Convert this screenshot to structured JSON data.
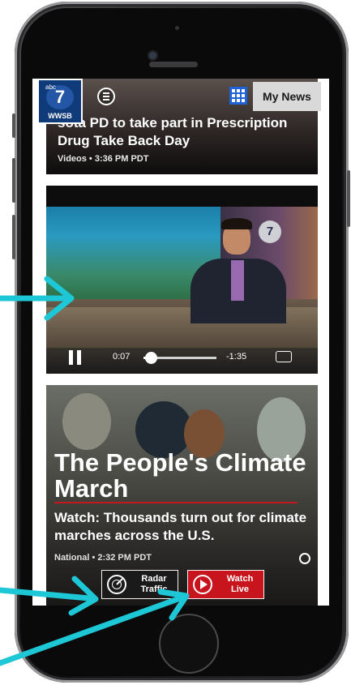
{
  "colors": {
    "annotation_arrow": "#1ec7d6",
    "accent_red": "#c8151d",
    "grid_button_blue": "#1e63d6"
  },
  "app_header": {
    "logo_network": "abc",
    "logo_number": "7",
    "logo_callsign": "WWSB",
    "menu_icon": "hamburger-circle-icon",
    "grid_icon": "grid-icon",
    "my_news_label": "My News"
  },
  "stories": [
    {
      "headline": "sota PD to take part in Prescription Drug Take Back Day",
      "meta": "Videos • 3:36 PM PDT"
    },
    {
      "type": "video",
      "elapsed": "0:07",
      "remaining": "-1:35",
      "progress_fraction": 0.1,
      "badge": "7"
    },
    {
      "overlay_title": "The People's Climate March",
      "headline": "Watch: Thousands turn out for climate marches across the U.S.",
      "meta": "National • 2:32 PM PDT"
    }
  ],
  "floating_buttons": {
    "radar_line1": "Radar",
    "radar_line2": "Traffic",
    "watch_line1": "Watch",
    "watch_line2": "Live"
  }
}
